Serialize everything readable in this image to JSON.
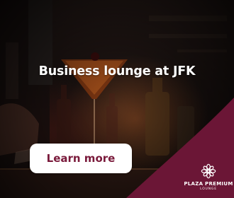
{
  "ad": {
    "headline": "Business lounge at JFK",
    "cta_label": "Learn more",
    "brand": {
      "name": "PLAZA PREMIUM",
      "subtitle": "LOUNGE",
      "logo_icon": "flower-logo-icon"
    },
    "colors": {
      "accent": "#7a1a3b",
      "wedge": "#6b1636",
      "cta_bg": "#ffffff",
      "text": "#ffffff"
    }
  }
}
